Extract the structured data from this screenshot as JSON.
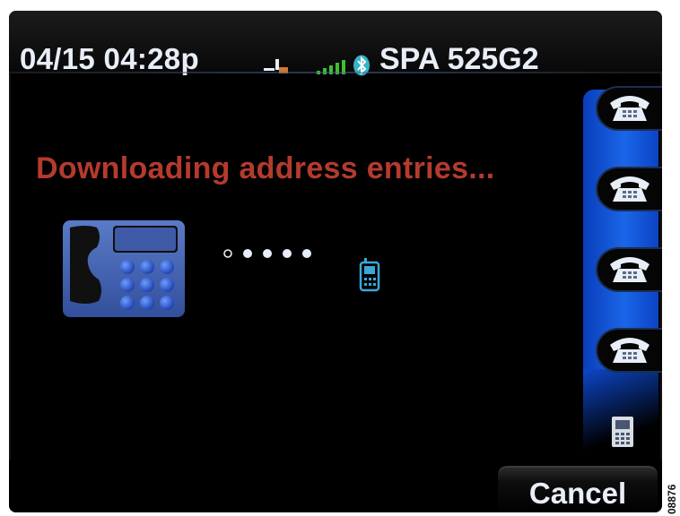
{
  "status_bar": {
    "datetime": "04/15 04:28p",
    "model": "SPA 525G2",
    "icons": [
      "lan-icon",
      "signal-icon",
      "bluetooth-icon"
    ]
  },
  "main": {
    "message": "Downloading address entries...",
    "graphic": "desk-phone-icon",
    "progress_icon": "transfer-dots",
    "target_icon": "cellphone-icon"
  },
  "line_keys": [
    {
      "icon": "phone-icon"
    },
    {
      "icon": "phone-icon"
    },
    {
      "icon": "phone-icon"
    },
    {
      "icon": "phone-icon"
    }
  ],
  "softkeys": {
    "cancel_label": "Cancel"
  },
  "figure_id": "08876",
  "colors": {
    "message": "#b53a2e",
    "accent_blue": "#1a66e8",
    "signal_green": "#3fbf2f",
    "bluetooth": "#37b3c4",
    "cellphone": "#3aa7d8"
  }
}
